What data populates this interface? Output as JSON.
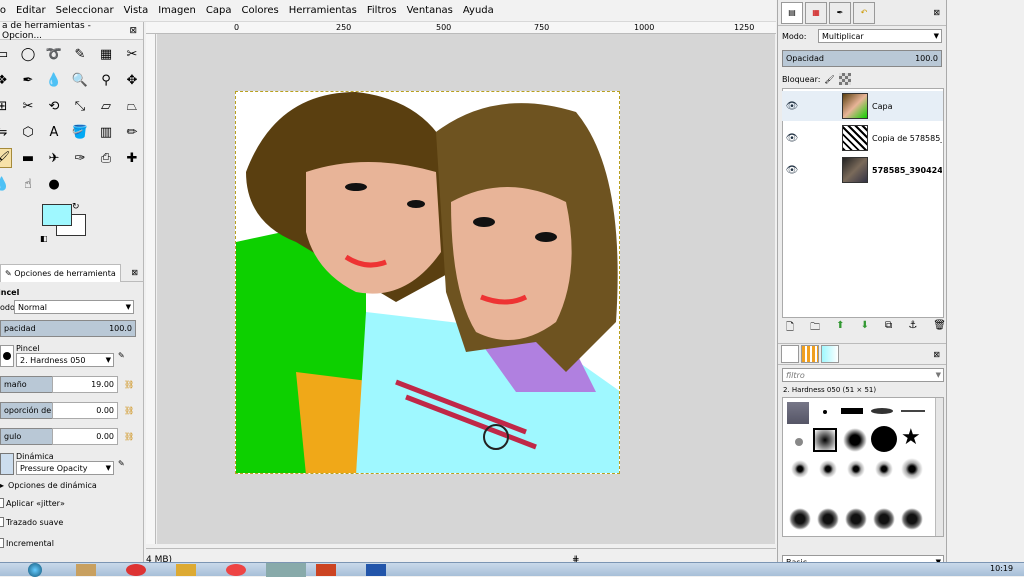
{
  "menu": [
    "vo",
    "Editar",
    "Seleccionar",
    "Vista",
    "Imagen",
    "Capa",
    "Colores",
    "Herramientas",
    "Filtros",
    "Ventanas",
    "Ayuda"
  ],
  "toolbox": {
    "title": "a de herramientas - Opcion...",
    "fg_color": "#9ff8ff",
    "tab_label": "Opciones de herramienta",
    "tool_name": "incel",
    "mode_label": "odo:",
    "mode_value": "Normal",
    "opacity_label": "pacidad",
    "opacity_value": "100.0",
    "brush_label": "Pincel",
    "brush_value": "2. Hardness 050",
    "size_label": "maño",
    "size_value": "19.00",
    "aspect_label": "oporción de aspecto",
    "aspect_value": "0.00",
    "angle_label": "gulo",
    "angle_value": "0.00",
    "dynamics_label": "Dinámica",
    "dynamics_value": "Pressure Opacity",
    "dyn_options": "Opciones de dinámica",
    "jitter": "Aplicar «jitter»",
    "smooth": "Trazado suave",
    "incremental": "Incremental"
  },
  "ruler": [
    "0",
    "250",
    "500",
    "750",
    "1000",
    "1250"
  ],
  "status": "4 MB)",
  "layers_panel": {
    "mode_label": "Modo:",
    "mode_value": "Multiplicar",
    "opacity_label": "Opacidad",
    "opacity_value": "100.0",
    "lock_label": "Bloquear:",
    "layers": [
      {
        "name": "Capa"
      },
      {
        "name": "Copia de 578585_39"
      },
      {
        "name": "578585_39042420"
      }
    ]
  },
  "brushes_panel": {
    "filter_placeholder": "filtro",
    "brush_name": "2. Hardness 050 (51 × 51)",
    "preset": "Basic."
  },
  "clock": "10:19"
}
